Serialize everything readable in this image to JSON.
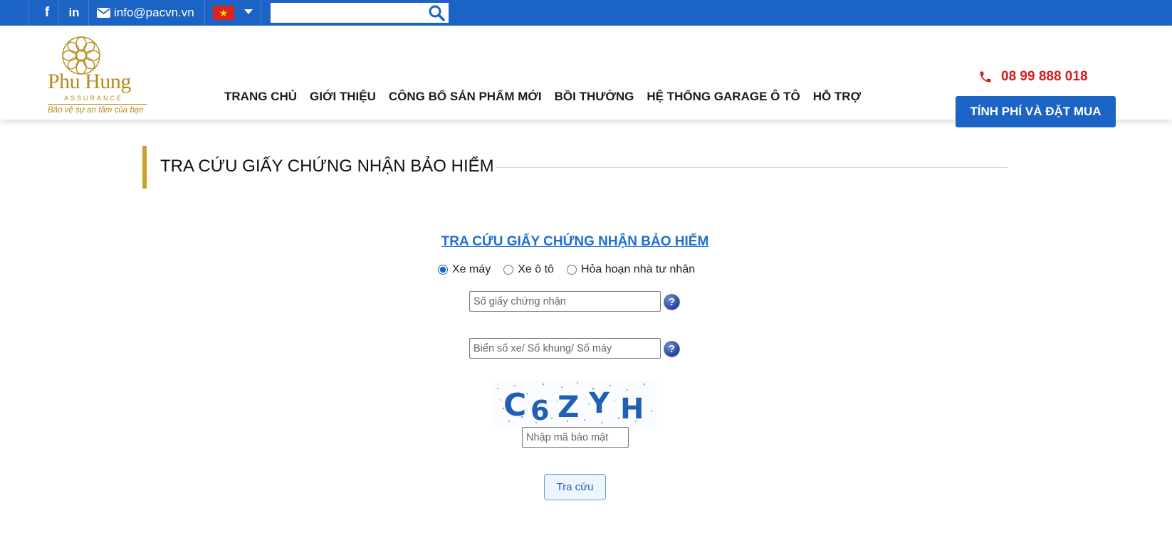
{
  "topbar": {
    "facebook_icon": "f",
    "linkedin_icon": "in",
    "email": "info@pacvn.vn",
    "language_flag": "vietnam-flag",
    "search": {
      "value": "",
      "placeholder": ""
    }
  },
  "header": {
    "logo": {
      "name": "Phu Hung",
      "sub": "ASSURANCE",
      "tagline": "Bảo vệ sự an tâm của bạn"
    },
    "nav": [
      {
        "label": "TRANG CHỦ"
      },
      {
        "label": "GIỚI THIỆU"
      },
      {
        "label": "CÔNG BỐ SẢN PHẨM MỚI"
      },
      {
        "label": "BỒI THƯỜNG"
      },
      {
        "label": "HỆ THỐNG GARAGE Ô TÔ"
      },
      {
        "label": "HỖ TRỢ"
      }
    ],
    "phone": "08 99 888 018",
    "cta_label": "TÍNH PHÍ VÀ ĐẶT MUA"
  },
  "page": {
    "title": "TRA CỨU GIẤY CHỨNG NHẬN BẢO HIỂM"
  },
  "form": {
    "title": "TRA CỨU GIẤY CHỨNG NHẬN BẢO HIỂM",
    "radios": [
      {
        "label": "Xe máy",
        "checked": true
      },
      {
        "label": "Xe ô tô",
        "checked": false
      },
      {
        "label": "Hỏa hoạn nhà tư nhân",
        "checked": false
      }
    ],
    "certificate_field": {
      "value": "",
      "placeholder": "Số giấy chứng nhận"
    },
    "plate_field": {
      "value": "",
      "placeholder": "Biển số xe/ Số khung/ Số máy"
    },
    "captcha_text": "C6ZYH",
    "captcha_field": {
      "value": "",
      "placeholder": "Nhập mã bảo mật"
    },
    "help_icon": "?",
    "submit_label": "Tra cứu"
  },
  "colors": {
    "topbar": "#1b63c4",
    "accent_gold": "#c9a12a",
    "phone_red": "#d0211c",
    "link_blue": "#1b6fd6"
  }
}
